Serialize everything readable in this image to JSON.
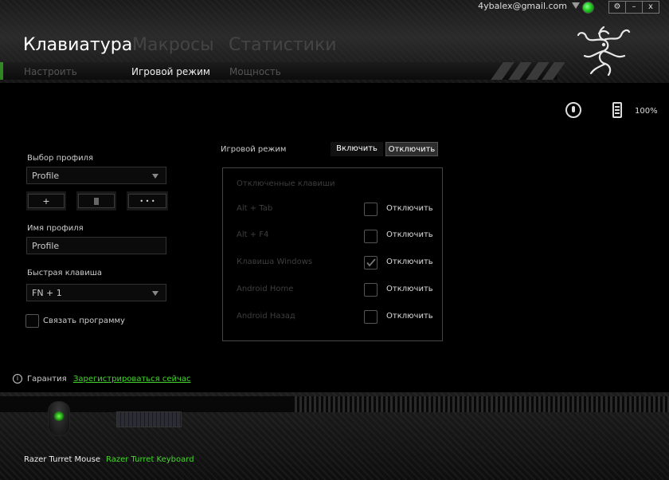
{
  "window": {
    "user_email": "4ybalex@gmail.com",
    "settings_icon": "gear-icon",
    "minimize_label": "–",
    "close_label": "x"
  },
  "main_tabs": [
    {
      "label": "Клавиатура",
      "active": true
    },
    {
      "label": "Макросы",
      "active": false
    },
    {
      "label": "Статистики",
      "active": false
    }
  ],
  "sub_tabs": [
    {
      "label": "Настроить",
      "active": false
    },
    {
      "label": "Игровой режим",
      "active": true
    },
    {
      "label": "Мощность",
      "active": false
    }
  ],
  "device_status": {
    "mouse_icon": "mouse-icon",
    "battery_icon": "battery-icon",
    "battery_level": "100%"
  },
  "profile": {
    "select_label": "Выбор профиля",
    "selected_profile": "Profile",
    "add_label": "+",
    "delete_icon": "trash-icon",
    "more_label": "• • •",
    "name_label": "Имя профиля",
    "name_value": "Profile",
    "hotkey_label": "Быстрая клавиша",
    "hotkey_value": "FN + 1",
    "link_program_label": "Связать программу",
    "link_program_checked": false
  },
  "game_mode": {
    "label": "Игровой режим",
    "enable_label": "Включить",
    "disable_label": "Отключить",
    "active_option": "Отключить",
    "panel_title": "Отключенные клавиши",
    "keys": [
      {
        "name": "Alt + Tab",
        "off_label": "Отключить",
        "checked": false
      },
      {
        "name": "Alt + F4",
        "off_label": "Отключить",
        "checked": false
      },
      {
        "name": "Клавиша Windows",
        "off_label": "Отключить",
        "checked": true
      },
      {
        "name": "Android Home",
        "off_label": "Отключить",
        "checked": false
      },
      {
        "name": "Android Назад",
        "off_label": "Отключить",
        "checked": false
      }
    ]
  },
  "warranty": {
    "label": "Гарантия",
    "link": "Зарегистрироваться сейчас"
  },
  "devices": [
    {
      "name": "Razer Turret Mouse",
      "active": false
    },
    {
      "name": "Razer Turret Keyboard",
      "active": true
    }
  ],
  "colors": {
    "accent": "#44d62c",
    "background": "#000000"
  }
}
